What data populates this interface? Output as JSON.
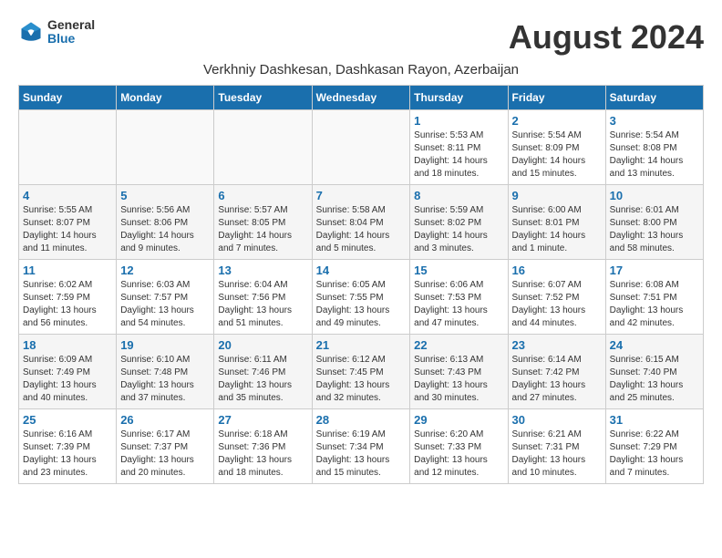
{
  "header": {
    "logo_general": "General",
    "logo_blue": "Blue",
    "month_year": "August 2024",
    "location": "Verkhniy Dashkesan, Dashkasan Rayon, Azerbaijan"
  },
  "columns": [
    "Sunday",
    "Monday",
    "Tuesday",
    "Wednesday",
    "Thursday",
    "Friday",
    "Saturday"
  ],
  "weeks": [
    [
      {
        "day": "",
        "info": ""
      },
      {
        "day": "",
        "info": ""
      },
      {
        "day": "",
        "info": ""
      },
      {
        "day": "",
        "info": ""
      },
      {
        "day": "1",
        "info": "Sunrise: 5:53 AM\nSunset: 8:11 PM\nDaylight: 14 hours\nand 18 minutes."
      },
      {
        "day": "2",
        "info": "Sunrise: 5:54 AM\nSunset: 8:09 PM\nDaylight: 14 hours\nand 15 minutes."
      },
      {
        "day": "3",
        "info": "Sunrise: 5:54 AM\nSunset: 8:08 PM\nDaylight: 14 hours\nand 13 minutes."
      }
    ],
    [
      {
        "day": "4",
        "info": "Sunrise: 5:55 AM\nSunset: 8:07 PM\nDaylight: 14 hours\nand 11 minutes."
      },
      {
        "day": "5",
        "info": "Sunrise: 5:56 AM\nSunset: 8:06 PM\nDaylight: 14 hours\nand 9 minutes."
      },
      {
        "day": "6",
        "info": "Sunrise: 5:57 AM\nSunset: 8:05 PM\nDaylight: 14 hours\nand 7 minutes."
      },
      {
        "day": "7",
        "info": "Sunrise: 5:58 AM\nSunset: 8:04 PM\nDaylight: 14 hours\nand 5 minutes."
      },
      {
        "day": "8",
        "info": "Sunrise: 5:59 AM\nSunset: 8:02 PM\nDaylight: 14 hours\nand 3 minutes."
      },
      {
        "day": "9",
        "info": "Sunrise: 6:00 AM\nSunset: 8:01 PM\nDaylight: 14 hours\nand 1 minute."
      },
      {
        "day": "10",
        "info": "Sunrise: 6:01 AM\nSunset: 8:00 PM\nDaylight: 13 hours\nand 58 minutes."
      }
    ],
    [
      {
        "day": "11",
        "info": "Sunrise: 6:02 AM\nSunset: 7:59 PM\nDaylight: 13 hours\nand 56 minutes."
      },
      {
        "day": "12",
        "info": "Sunrise: 6:03 AM\nSunset: 7:57 PM\nDaylight: 13 hours\nand 54 minutes."
      },
      {
        "day": "13",
        "info": "Sunrise: 6:04 AM\nSunset: 7:56 PM\nDaylight: 13 hours\nand 51 minutes."
      },
      {
        "day": "14",
        "info": "Sunrise: 6:05 AM\nSunset: 7:55 PM\nDaylight: 13 hours\nand 49 minutes."
      },
      {
        "day": "15",
        "info": "Sunrise: 6:06 AM\nSunset: 7:53 PM\nDaylight: 13 hours\nand 47 minutes."
      },
      {
        "day": "16",
        "info": "Sunrise: 6:07 AM\nSunset: 7:52 PM\nDaylight: 13 hours\nand 44 minutes."
      },
      {
        "day": "17",
        "info": "Sunrise: 6:08 AM\nSunset: 7:51 PM\nDaylight: 13 hours\nand 42 minutes."
      }
    ],
    [
      {
        "day": "18",
        "info": "Sunrise: 6:09 AM\nSunset: 7:49 PM\nDaylight: 13 hours\nand 40 minutes."
      },
      {
        "day": "19",
        "info": "Sunrise: 6:10 AM\nSunset: 7:48 PM\nDaylight: 13 hours\nand 37 minutes."
      },
      {
        "day": "20",
        "info": "Sunrise: 6:11 AM\nSunset: 7:46 PM\nDaylight: 13 hours\nand 35 minutes."
      },
      {
        "day": "21",
        "info": "Sunrise: 6:12 AM\nSunset: 7:45 PM\nDaylight: 13 hours\nand 32 minutes."
      },
      {
        "day": "22",
        "info": "Sunrise: 6:13 AM\nSunset: 7:43 PM\nDaylight: 13 hours\nand 30 minutes."
      },
      {
        "day": "23",
        "info": "Sunrise: 6:14 AM\nSunset: 7:42 PM\nDaylight: 13 hours\nand 27 minutes."
      },
      {
        "day": "24",
        "info": "Sunrise: 6:15 AM\nSunset: 7:40 PM\nDaylight: 13 hours\nand 25 minutes."
      }
    ],
    [
      {
        "day": "25",
        "info": "Sunrise: 6:16 AM\nSunset: 7:39 PM\nDaylight: 13 hours\nand 23 minutes."
      },
      {
        "day": "26",
        "info": "Sunrise: 6:17 AM\nSunset: 7:37 PM\nDaylight: 13 hours\nand 20 minutes."
      },
      {
        "day": "27",
        "info": "Sunrise: 6:18 AM\nSunset: 7:36 PM\nDaylight: 13 hours\nand 18 minutes."
      },
      {
        "day": "28",
        "info": "Sunrise: 6:19 AM\nSunset: 7:34 PM\nDaylight: 13 hours\nand 15 minutes."
      },
      {
        "day": "29",
        "info": "Sunrise: 6:20 AM\nSunset: 7:33 PM\nDaylight: 13 hours\nand 12 minutes."
      },
      {
        "day": "30",
        "info": "Sunrise: 6:21 AM\nSunset: 7:31 PM\nDaylight: 13 hours\nand 10 minutes."
      },
      {
        "day": "31",
        "info": "Sunrise: 6:22 AM\nSunset: 7:29 PM\nDaylight: 13 hours\nand 7 minutes."
      }
    ]
  ]
}
